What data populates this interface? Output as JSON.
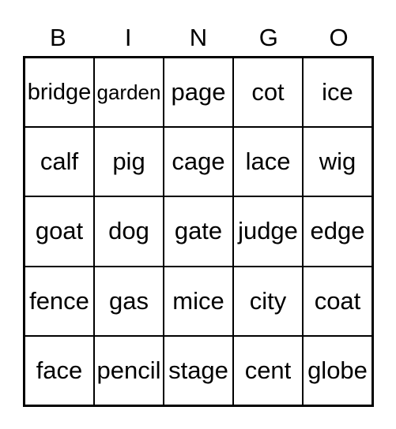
{
  "header": [
    "B",
    "I",
    "N",
    "G",
    "O"
  ],
  "cells": [
    [
      {
        "t": "bridge",
        "s": 24
      },
      {
        "t": "garden",
        "s": 21
      },
      {
        "t": "page",
        "s": 31
      },
      {
        "t": "cot",
        "s": 31
      },
      {
        "t": "ice",
        "s": 31
      }
    ],
    [
      {
        "t": "calf",
        "s": 31
      },
      {
        "t": "pig",
        "s": 31
      },
      {
        "t": "cage",
        "s": 31
      },
      {
        "t": "lace",
        "s": 31
      },
      {
        "t": "wig",
        "s": 31
      }
    ],
    [
      {
        "t": "goat",
        "s": 31
      },
      {
        "t": "dog",
        "s": 31
      },
      {
        "t": "gate",
        "s": 31
      },
      {
        "t": "judge",
        "s": 24
      },
      {
        "t": "edge",
        "s": 29
      }
    ],
    [
      {
        "t": "fence",
        "s": 25
      },
      {
        "t": "gas",
        "s": 31
      },
      {
        "t": "mice",
        "s": 31
      },
      {
        "t": "city",
        "s": 31
      },
      {
        "t": "coat",
        "s": 31
      }
    ],
    [
      {
        "t": "face",
        "s": 31
      },
      {
        "t": "pencil",
        "s": 24
      },
      {
        "t": "stage",
        "s": 27
      },
      {
        "t": "cent",
        "s": 31
      },
      {
        "t": "globe",
        "s": 26
      }
    ]
  ]
}
